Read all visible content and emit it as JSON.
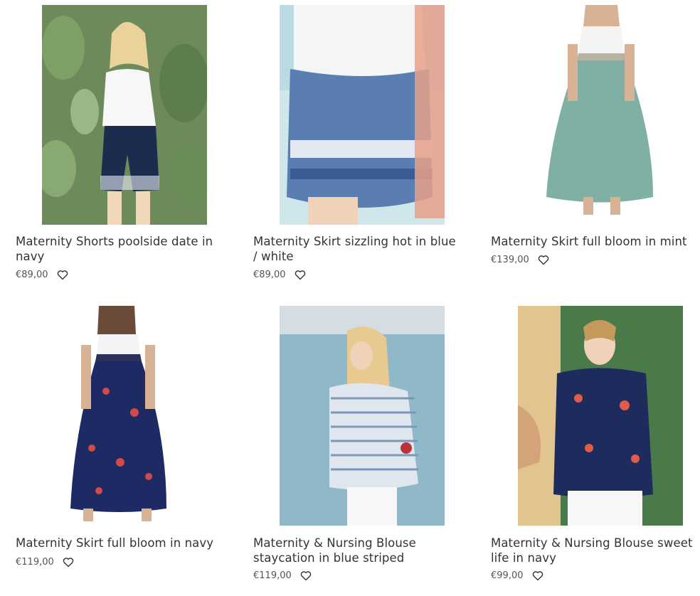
{
  "products": [
    {
      "title": "Maternity Shorts poolside date in navy",
      "price": "€89,00",
      "image": "woman in white tee and navy patterned shorts among cacti"
    },
    {
      "title": "Maternity Skirt sizzling hot in blue / white",
      "price": "€89,00",
      "image": "blue and white patterned skirt with tie, beach background"
    },
    {
      "title": "Maternity Skirt full bloom in mint",
      "price": "€139,00",
      "image": "long mint maxi skirt with white top"
    },
    {
      "title": "Maternity Skirt full bloom in navy",
      "price": "€119,00",
      "image": "long navy floral maxi skirt with white top"
    },
    {
      "title": "Maternity & Nursing Blouse staycation in blue striped",
      "price": "€119,00",
      "image": "woman in blue striped blouse by the sea"
    },
    {
      "title": "Maternity & Nursing Blouse sweet life in navy",
      "price": "€99,00",
      "image": "woman in navy floral blouse by green door"
    }
  ],
  "icons": {
    "wishlist": "heart-outline-icon"
  },
  "colors": {
    "text": "#333333",
    "price": "#555555"
  }
}
